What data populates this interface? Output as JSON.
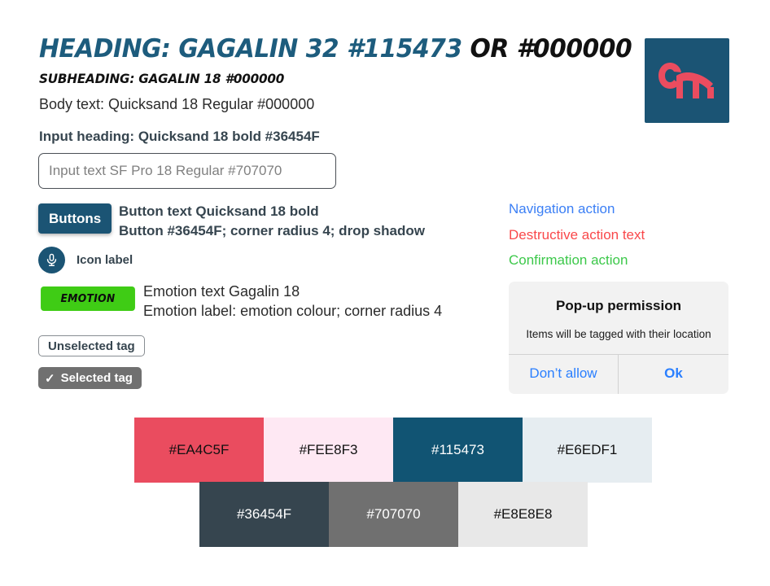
{
  "typography": {
    "heading_main": "HEADING: GAGALIN 32 #115473 ",
    "heading_or": "OR #000000",
    "subheading": "SUBHEADING: GAGALIN 18 #000000",
    "body_text": "Body text: Quicksand 18 Regular #000000",
    "input_heading": "Input heading: Quicksand 18 bold #36454F"
  },
  "input": {
    "placeholder": "Input text SF Pro 18 Regular #707070",
    "value": ""
  },
  "buttons": {
    "primary_label": "Buttons",
    "desc_line1": "Button text Quicksand 18 bold",
    "desc_line2": "Button #36454F; corner radius 4; drop shadow"
  },
  "icon_row": {
    "icon": "microphone-icon",
    "label": "Icon label"
  },
  "emotion": {
    "tag_label": "EMOTION",
    "desc_line1": "Emotion text Gagalin 18",
    "desc_line2": "Emotion label: emotion colour; corner radius 4"
  },
  "tags": {
    "unselected_label": "Unselected tag",
    "selected_label": "Selected tag",
    "selected_check": "✓"
  },
  "actions": {
    "navigation": "Navigation action",
    "destructive": "Destructive action text",
    "confirmation": "Confirmation action",
    "navigation_color": "#3B7FF5",
    "destructive_color": "#F9484A",
    "confirmation_color": "#3CC84A"
  },
  "popup": {
    "title": "Pop-up permission",
    "message": "Items will be tagged with their location",
    "deny_label": "Don’t allow",
    "confirm_label": "Ok"
  },
  "logo": {
    "text": "cm",
    "background": "#1B5474",
    "mark_color": "#EA4C5F"
  },
  "palette": {
    "row1": [
      {
        "hex": "#EA4C5F",
        "label": "#EA4C5F",
        "text_color": "#111111"
      },
      {
        "hex": "#FEE8F3",
        "label": "#FEE8F3",
        "text_color": "#111111"
      },
      {
        "hex": "#115473",
        "label": "#115473",
        "text_color": "#FFFFFF"
      },
      {
        "hex": "#E6EDF1",
        "label": "#E6EDF1",
        "text_color": "#111111"
      }
    ],
    "row2": [
      {
        "hex": "#36454F",
        "label": "#36454F",
        "text_color": "#FFFFFF"
      },
      {
        "hex": "#707070",
        "label": "#707070",
        "text_color": "#FFFFFF"
      },
      {
        "hex": "#E8E8E8",
        "label": "#E8E8E8",
        "text_color": "#111111"
      }
    ]
  }
}
